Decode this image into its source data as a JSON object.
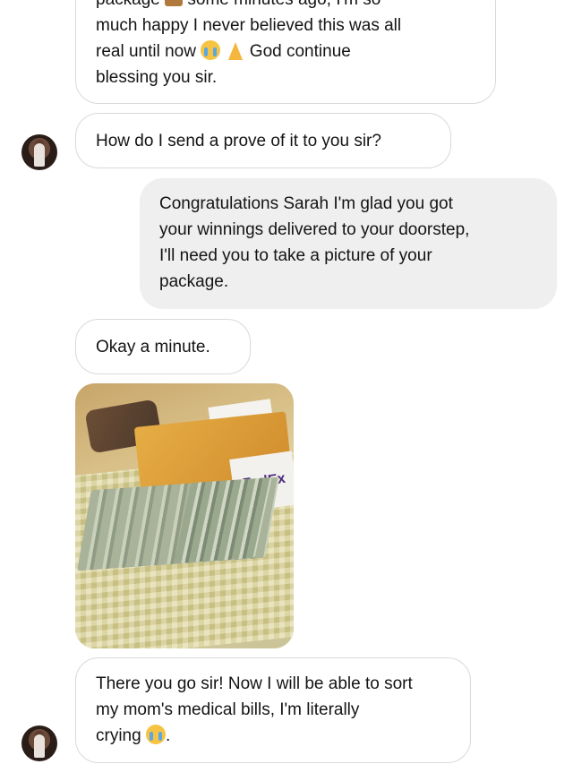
{
  "messages": [
    {
      "id": "m1",
      "direction": "incoming",
      "lines": [
        "package",
        "some minutes ago, I'm so",
        "much happy I never believed this was all",
        "real until now",
        "God continue",
        "blessing you sir."
      ]
    },
    {
      "id": "m2",
      "direction": "incoming",
      "text": "How do I send a prove of it to you sir?"
    },
    {
      "id": "m3",
      "direction": "outgoing",
      "lines": [
        "Congratulations Sarah I'm glad you got",
        "your winnings delivered to your doorstep,",
        "I'll need you to take a picture of your",
        "package."
      ]
    },
    {
      "id": "m4",
      "direction": "incoming",
      "text": "Okay a minute."
    },
    {
      "id": "m5",
      "direction": "incoming",
      "type": "photo",
      "photo_text": "FedEx"
    },
    {
      "id": "m6",
      "direction": "incoming",
      "lines": [
        "There you go sir! Now I will be able to sort",
        "my mom's medical bills, I'm literally",
        "crying",
        "."
      ]
    }
  ]
}
